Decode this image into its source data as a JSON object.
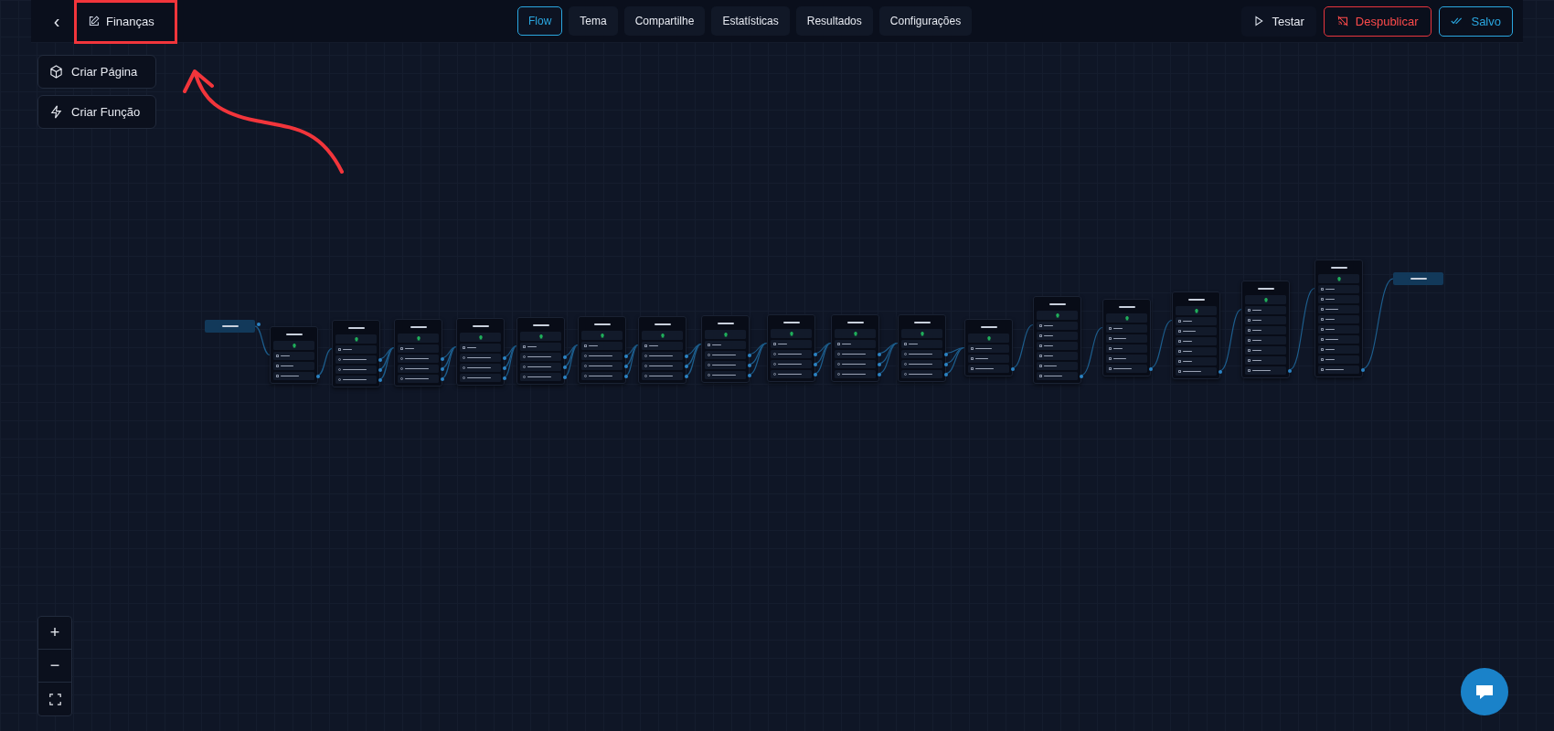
{
  "topbar": {
    "back": "‹",
    "project": "Finanças",
    "tabs": [
      {
        "label": "Flow",
        "selected": true
      },
      {
        "label": "Tema",
        "selected": false
      },
      {
        "label": "Compartilhe",
        "selected": false
      },
      {
        "label": "Estatísticas",
        "selected": false
      },
      {
        "label": "Resultados",
        "selected": false
      },
      {
        "label": "Configurações",
        "selected": false
      }
    ],
    "actions": [
      {
        "label": "Testar",
        "kind": "test"
      },
      {
        "label": "Despublicar",
        "kind": "danger"
      },
      {
        "label": "Salvo",
        "kind": "saved"
      }
    ]
  },
  "side_buttons": [
    {
      "label": "Criar Página",
      "kind": "page"
    },
    {
      "label": "Criar Função",
      "kind": "function"
    }
  ],
  "zoom_controls": [
    "+",
    "−"
  ],
  "flow": {
    "nodes": [
      {
        "items": [
          {
            "kind": "text"
          },
          {
            "kind": "image"
          },
          {
            "kind": "button"
          }
        ]
      },
      {
        "items": [
          {
            "kind": "text"
          },
          {
            "kind": "option"
          },
          {
            "kind": "option"
          },
          {
            "kind": "option"
          }
        ]
      },
      {
        "items": [
          {
            "kind": "text"
          },
          {
            "kind": "option"
          },
          {
            "kind": "option"
          },
          {
            "kind": "option"
          }
        ]
      },
      {
        "items": [
          {
            "kind": "text"
          },
          {
            "kind": "option"
          },
          {
            "kind": "option"
          },
          {
            "kind": "option"
          }
        ]
      },
      {
        "items": [
          {
            "kind": "text"
          },
          {
            "kind": "option"
          },
          {
            "kind": "option"
          },
          {
            "kind": "option"
          }
        ]
      },
      {
        "items": [
          {
            "kind": "text"
          },
          {
            "kind": "option"
          },
          {
            "kind": "option"
          },
          {
            "kind": "option"
          }
        ]
      },
      {
        "items": [
          {
            "kind": "text"
          },
          {
            "kind": "option"
          },
          {
            "kind": "option"
          },
          {
            "kind": "option"
          }
        ]
      },
      {
        "items": [
          {
            "kind": "text"
          },
          {
            "kind": "option"
          },
          {
            "kind": "option"
          },
          {
            "kind": "option"
          }
        ]
      },
      {
        "items": [
          {
            "kind": "text"
          },
          {
            "kind": "option"
          },
          {
            "kind": "option"
          },
          {
            "kind": "option"
          }
        ]
      },
      {
        "items": [
          {
            "kind": "text"
          },
          {
            "kind": "option"
          },
          {
            "kind": "option"
          },
          {
            "kind": "option"
          }
        ]
      },
      {
        "items": [
          {
            "kind": "text"
          },
          {
            "kind": "option"
          },
          {
            "kind": "option"
          },
          {
            "kind": "option"
          }
        ]
      },
      {
        "items": [
          {
            "kind": "loader"
          },
          {
            "kind": "image"
          },
          {
            "kind": "button"
          }
        ]
      },
      {
        "items": [
          {
            "kind": "text"
          },
          {
            "kind": "text"
          },
          {
            "kind": "text"
          },
          {
            "kind": "text"
          },
          {
            "kind": "image"
          },
          {
            "kind": "button"
          }
        ]
      },
      {
        "items": [
          {
            "kind": "text"
          },
          {
            "kind": "image"
          },
          {
            "kind": "text"
          },
          {
            "kind": "image"
          },
          {
            "kind": "button"
          }
        ]
      },
      {
        "items": [
          {
            "kind": "text"
          },
          {
            "kind": "image"
          },
          {
            "kind": "text"
          },
          {
            "kind": "text"
          },
          {
            "kind": "text"
          },
          {
            "kind": "button"
          }
        ]
      },
      {
        "items": [
          {
            "kind": "text"
          },
          {
            "kind": "text"
          },
          {
            "kind": "text"
          },
          {
            "kind": "text"
          },
          {
            "kind": "text"
          },
          {
            "kind": "text"
          },
          {
            "kind": "button"
          }
        ]
      },
      {
        "items": [
          {
            "kind": "text"
          },
          {
            "kind": "text"
          },
          {
            "kind": "image"
          },
          {
            "kind": "text"
          },
          {
            "kind": "text"
          },
          {
            "kind": "image"
          },
          {
            "kind": "text"
          },
          {
            "kind": "text"
          },
          {
            "kind": "button"
          }
        ]
      }
    ]
  }
}
